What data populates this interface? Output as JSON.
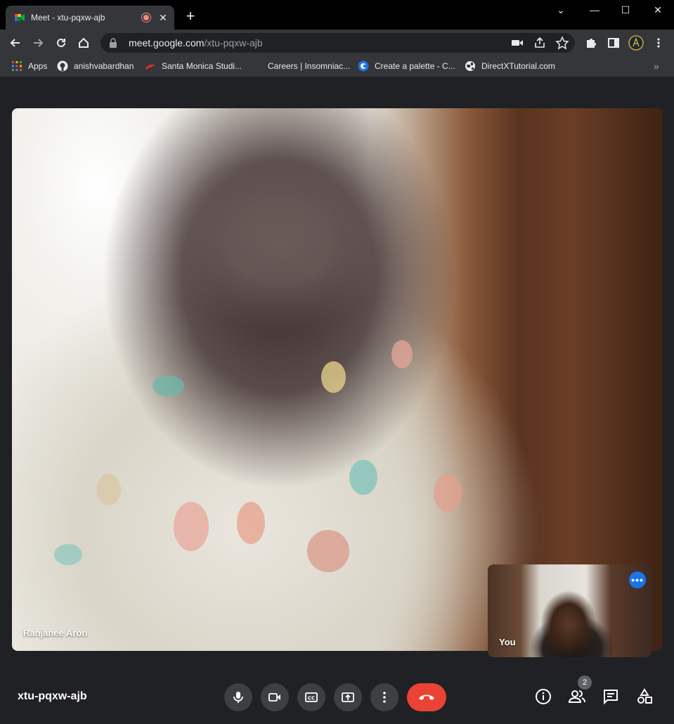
{
  "browser": {
    "tab_title": "Meet - xtu-pqxw-ajb",
    "url_host": "meet.google.com",
    "url_path": "/xtu-pqxw-ajb",
    "bookmarks": [
      {
        "label": "Apps",
        "icon": "apps-grid-icon"
      },
      {
        "label": "anishvabardhan",
        "icon": "github-icon"
      },
      {
        "label": "Santa Monica Studi...",
        "icon": "santa-monica-icon"
      },
      {
        "label": "Careers | Insomniac...",
        "icon": "insomniac-icon"
      },
      {
        "label": "Create a palette - C...",
        "icon": "coolors-icon"
      },
      {
        "label": "DirectXTutorial.com",
        "icon": "globe-icon"
      }
    ],
    "bookmarks_overflow": "»",
    "new_tab": "+",
    "tab_close": "✕",
    "window_controls": {
      "chevron": "⌄",
      "minimize": "—",
      "maximize": "☐",
      "close": "✕"
    }
  },
  "meet": {
    "meeting_code": "xtu-pqxw-ajb",
    "main_participant": "Ranjanee Aron",
    "self_label": "You",
    "self_more": "•••",
    "participant_count": "2"
  },
  "colors": {
    "end_call": "#ea4335",
    "control_bg": "#3c4043",
    "page_bg": "#202124",
    "accent_blue": "#1a73e8"
  }
}
